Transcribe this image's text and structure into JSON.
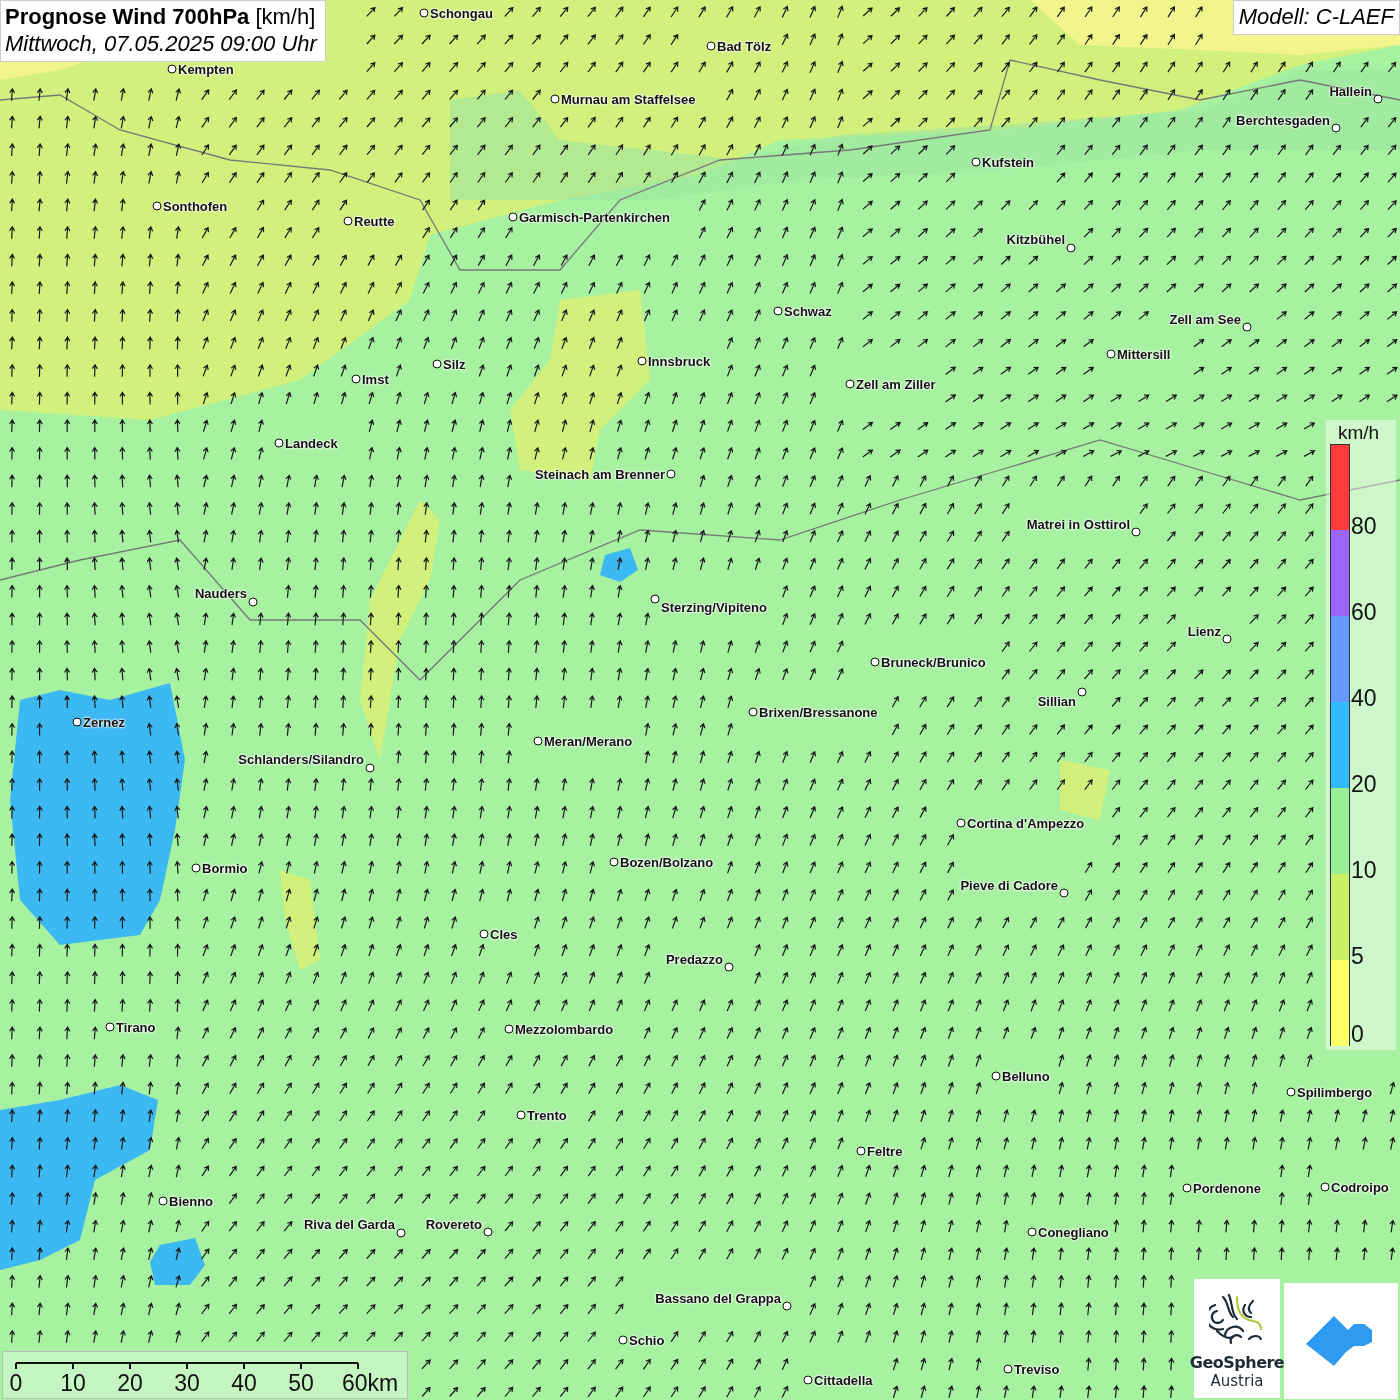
{
  "title": {
    "heading": "**Prognose Wind 700hPa** [km/h]",
    "time": "Mittwoch, 07.05.2025 09:00 Uhr"
  },
  "model": "Modell: C-LAEF",
  "cities": [
    {
      "name": "Schongau"
    },
    {
      "name": "Bad Tölz"
    },
    {
      "name": "Kempten"
    },
    {
      "name": "Murnau am Staffelsee"
    },
    {
      "name": "Hallein"
    },
    {
      "name": "Berchtesgaden"
    },
    {
      "name": "Kufstein"
    },
    {
      "name": "Sonthofen"
    },
    {
      "name": "Reutte"
    },
    {
      "name": "Garmisch-Partenkirchen"
    },
    {
      "name": "Kitzbühel"
    },
    {
      "name": "Schwaz"
    },
    {
      "name": "Zell am See"
    },
    {
      "name": "Mittersill"
    },
    {
      "name": "Innsbruck"
    },
    {
      "name": "Silz"
    },
    {
      "name": "Imst"
    },
    {
      "name": "Zell am Ziller"
    },
    {
      "name": "Landeck"
    },
    {
      "name": "Steinach am Brenner"
    },
    {
      "name": "Matrei in Osttirol"
    },
    {
      "name": "Nauders"
    },
    {
      "name": "Sterzing/Vipiteno"
    },
    {
      "name": "Lienz"
    },
    {
      "name": "Bruneck/Brunico"
    },
    {
      "name": "Sillian"
    },
    {
      "name": "Zernez"
    },
    {
      "name": "Brixen/Bressanone"
    },
    {
      "name": "Meran/Merano"
    },
    {
      "name": "Schlanders/Silandro"
    },
    {
      "name": "Cortina d'Ampezzo"
    },
    {
      "name": "Bozen/Bolzano"
    },
    {
      "name": "Bormio"
    },
    {
      "name": "Pieve di Cadore"
    },
    {
      "name": "Cles"
    },
    {
      "name": "Predazzo"
    },
    {
      "name": "Tirano"
    },
    {
      "name": "Mezzolombardo"
    },
    {
      "name": "Belluno"
    },
    {
      "name": "Spilimbergo"
    },
    {
      "name": "Trento"
    },
    {
      "name": "Feltre"
    },
    {
      "name": "Pordenone"
    },
    {
      "name": "Codroipo"
    },
    {
      "name": "Bienno"
    },
    {
      "name": "Riva del Garda"
    },
    {
      "name": "Rovereto"
    },
    {
      "name": "Conegliano"
    },
    {
      "name": "Bassano del Grappa"
    },
    {
      "name": "Schio"
    },
    {
      "name": "Treviso"
    },
    {
      "name": "Cittadella"
    }
  ],
  "legend": {
    "unit": "km/h",
    "bins": [
      {
        "label": "80",
        "color": "#ff3a3a"
      },
      {
        "label": "60",
        "color": "#9a66ff"
      },
      {
        "label": "40",
        "color": "#6699ff"
      },
      {
        "label": "20",
        "color": "#33bbff"
      },
      {
        "label": "10",
        "color": "#99f099"
      },
      {
        "label": "5",
        "color": "#ccf066"
      },
      {
        "label": "0",
        "color": "#ffff66"
      }
    ]
  },
  "scale_bar": {
    "ticks": [
      "0",
      "10",
      "20",
      "30",
      "40",
      "50",
      "60km"
    ]
  },
  "logo": {
    "name": "GeoSphere",
    "subtitle": "Austria"
  }
}
